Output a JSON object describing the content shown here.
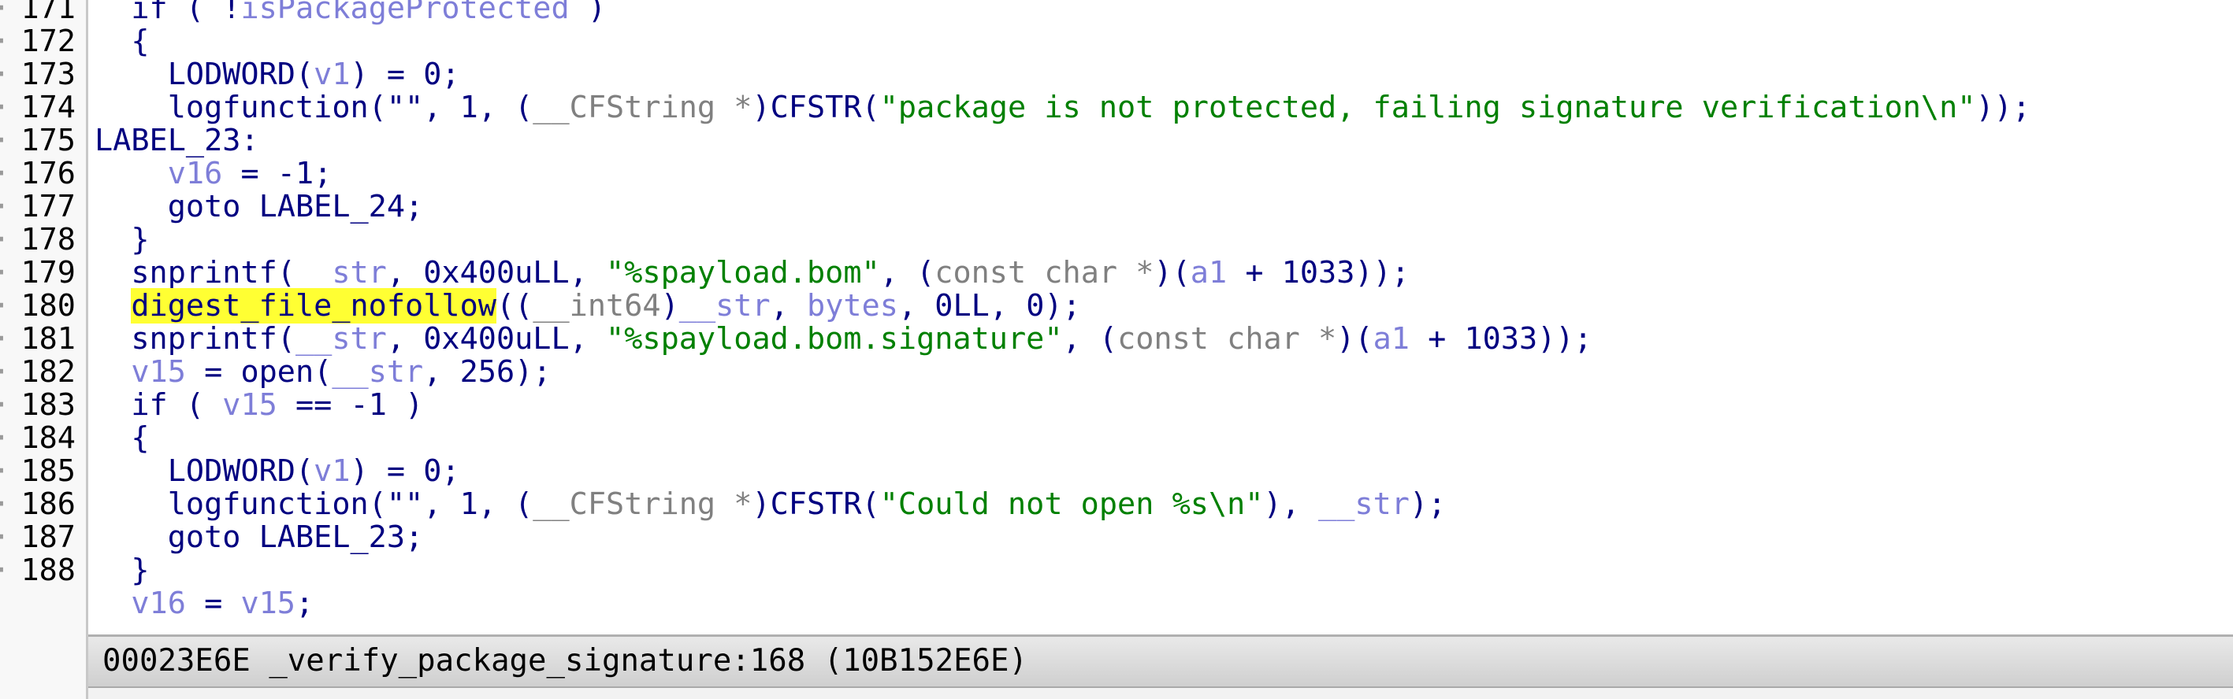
{
  "colors": {
    "plain": "#000080",
    "variable": "#7e7ed8",
    "type": "#808080",
    "string": "#008000",
    "highlight": "#ffff33",
    "statusbar": "#dcdcdc"
  },
  "code_lines": [
    {
      "num": "171",
      "tokens": [
        {
          "t": "  if ( !",
          "c": "plain"
        },
        {
          "t": "isPackageProtected",
          "c": "var"
        },
        {
          "t": " )",
          "c": "plain"
        }
      ]
    },
    {
      "num": "172",
      "tokens": [
        {
          "t": "  {",
          "c": "plain"
        }
      ]
    },
    {
      "num": "173",
      "tokens": [
        {
          "t": "    LODWORD(",
          "c": "plain"
        },
        {
          "t": "v1",
          "c": "var"
        },
        {
          "t": ") = 0;",
          "c": "plain"
        }
      ]
    },
    {
      "num": "174",
      "tokens": [
        {
          "t": "    logfunction(\"\", 1, (",
          "c": "plain"
        },
        {
          "t": "__CFString *",
          "c": "type"
        },
        {
          "t": ")CFSTR(",
          "c": "plain"
        },
        {
          "t": "\"package is not protected, failing signature verification\\n\"",
          "c": "str"
        },
        {
          "t": "));",
          "c": "plain"
        }
      ]
    },
    {
      "num": "175",
      "tokens": [
        {
          "t": "LABEL_23:",
          "c": "plain"
        }
      ]
    },
    {
      "num": "176",
      "tokens": [
        {
          "t": "    ",
          "c": "plain"
        },
        {
          "t": "v16",
          "c": "var"
        },
        {
          "t": " = -1;",
          "c": "plain"
        }
      ]
    },
    {
      "num": "177",
      "tokens": [
        {
          "t": "    goto LABEL_24;",
          "c": "plain"
        }
      ]
    },
    {
      "num": "178",
      "tokens": [
        {
          "t": "  }",
          "c": "plain"
        }
      ]
    },
    {
      "num": "179",
      "tokens": [
        {
          "t": "  snprintf(",
          "c": "plain"
        },
        {
          "t": "__str",
          "c": "var"
        },
        {
          "t": ", 0x400uLL, ",
          "c": "plain"
        },
        {
          "t": "\"%spayload.bom\"",
          "c": "str"
        },
        {
          "t": ", (",
          "c": "plain"
        },
        {
          "t": "const char *",
          "c": "type"
        },
        {
          "t": ")(",
          "c": "plain"
        },
        {
          "t": "a1",
          "c": "var"
        },
        {
          "t": " + 1033));",
          "c": "plain"
        }
      ]
    },
    {
      "num": "180",
      "tokens": [
        {
          "t": "  ",
          "c": "plain"
        },
        {
          "t": "digest_file_nofollow",
          "c": "hl"
        },
        {
          "t": "((",
          "c": "plain"
        },
        {
          "t": "__int64",
          "c": "type"
        },
        {
          "t": ")",
          "c": "plain"
        },
        {
          "t": "__str",
          "c": "var"
        },
        {
          "t": ", ",
          "c": "plain"
        },
        {
          "t": "bytes",
          "c": "var"
        },
        {
          "t": ", 0LL, 0);",
          "c": "plain"
        }
      ]
    },
    {
      "num": "181",
      "tokens": [
        {
          "t": "  snprintf(",
          "c": "plain"
        },
        {
          "t": "__str",
          "c": "var"
        },
        {
          "t": ", 0x400uLL, ",
          "c": "plain"
        },
        {
          "t": "\"%spayload.bom.signature\"",
          "c": "str"
        },
        {
          "t": ", (",
          "c": "plain"
        },
        {
          "t": "const char *",
          "c": "type"
        },
        {
          "t": ")(",
          "c": "plain"
        },
        {
          "t": "a1",
          "c": "var"
        },
        {
          "t": " + 1033));",
          "c": "plain"
        }
      ]
    },
    {
      "num": "182",
      "tokens": [
        {
          "t": "  ",
          "c": "plain"
        },
        {
          "t": "v15",
          "c": "var"
        },
        {
          "t": " = open(",
          "c": "plain"
        },
        {
          "t": "__str",
          "c": "var"
        },
        {
          "t": ", 256);",
          "c": "plain"
        }
      ]
    },
    {
      "num": "183",
      "tokens": [
        {
          "t": "  if ( ",
          "c": "plain"
        },
        {
          "t": "v15",
          "c": "var"
        },
        {
          "t": " == -1 )",
          "c": "plain"
        }
      ]
    },
    {
      "num": "184",
      "tokens": [
        {
          "t": "  {",
          "c": "plain"
        }
      ]
    },
    {
      "num": "185",
      "tokens": [
        {
          "t": "    LODWORD(",
          "c": "plain"
        },
        {
          "t": "v1",
          "c": "var"
        },
        {
          "t": ") = 0;",
          "c": "plain"
        }
      ]
    },
    {
      "num": "186",
      "tokens": [
        {
          "t": "    logfunction(\"\", 1, (",
          "c": "plain"
        },
        {
          "t": "__CFString *",
          "c": "type"
        },
        {
          "t": ")CFSTR(",
          "c": "plain"
        },
        {
          "t": "\"Could not open %s\\n\"",
          "c": "str"
        },
        {
          "t": "), ",
          "c": "plain"
        },
        {
          "t": "__str",
          "c": "var"
        },
        {
          "t": ");",
          "c": "plain"
        }
      ]
    },
    {
      "num": "187",
      "tokens": [
        {
          "t": "    goto LABEL_23;",
          "c": "plain"
        }
      ]
    },
    {
      "num": "188",
      "tokens": [
        {
          "t": "  }",
          "c": "plain"
        }
      ]
    },
    {
      "num": "",
      "tokens": [
        {
          "t": "  ",
          "c": "plain"
        },
        {
          "t": "v16",
          "c": "var"
        },
        {
          "t": " = ",
          "c": "plain"
        },
        {
          "t": "v15",
          "c": "var"
        },
        {
          "t": ";",
          "c": "plain"
        }
      ]
    }
  ],
  "statusbar": {
    "text": "00023E6E _verify_package_signature:168 (10B152E6E)"
  }
}
